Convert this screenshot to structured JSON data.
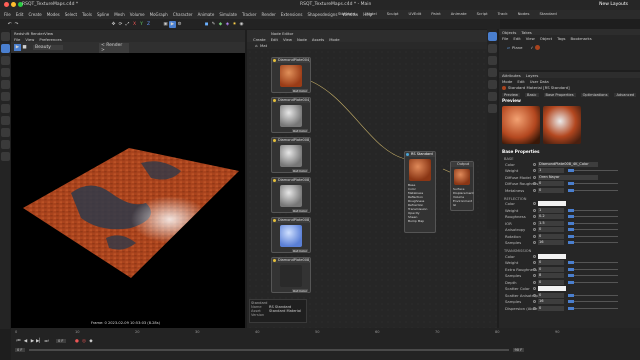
{
  "titlebar": {
    "title": "RSQT_TextureMaps.c4d * - Main",
    "file_tab": "RSQT_TextureMaps.c4d *",
    "new_layout": "New Layouts",
    "layouts": [
      "Standard",
      "Model",
      "Sculpt",
      "UVEdit",
      "Paint",
      "Animate",
      "Script",
      "Track",
      "Nodes",
      "Standard"
    ]
  },
  "main_menu": [
    "File",
    "Edit",
    "Create",
    "Modes",
    "Select",
    "Tools",
    "Spline",
    "Mesh",
    "Volume",
    "MoGraph",
    "Character",
    "Animate",
    "Simulate",
    "Tracker",
    "Render",
    "Extensions",
    "Shapesdesigns",
    "Window",
    "Help"
  ],
  "viewport": {
    "title": "Redshift RenderView",
    "menu": [
      "File",
      "View",
      "Preferences"
    ],
    "dropdown_left": "Beauty",
    "dropdown_mid": "< Render >",
    "frame_info": "Frame: 0  2023-02-09  10:53:03  (8.28s)"
  },
  "node_editor": {
    "title": "Node Editor",
    "menu": [
      "Create",
      "Edit",
      "View",
      "Node",
      "Assets",
      "Mode"
    ],
    "breadcrumb": "Mat",
    "texture_nodes": [
      {
        "name": "DiamondPlate004_4...",
        "port": "Out Color"
      },
      {
        "name": "DiamondPlate004_4...",
        "port": "Out Color"
      },
      {
        "name": "DiamondPlate008_4...",
        "port": "Out Color"
      },
      {
        "name": "DiamondPlate008_4...",
        "port": "Out Color"
      },
      {
        "name": "DiamondPlate008_4...",
        "port": "Out Color"
      },
      {
        "name": "DiamondPlate008_4...",
        "port": "Out Color"
      }
    ],
    "rs_node": {
      "name": "RS Standard",
      "ports": [
        "Base",
        "Color",
        "Metalness",
        "Reflection",
        "Roughness",
        "Refraction",
        "Transmission",
        "Opacity",
        "Sheen",
        "Bump Map"
      ]
    },
    "output_node": {
      "name": "Output",
      "ports": [
        "Surface",
        "Displacement",
        "Volume",
        "Environment",
        "GI"
      ]
    },
    "info_panel": {
      "rows": [
        {
          "label": "Name",
          "value": "RS Standard"
        },
        {
          "label": "Asset",
          "value": "Standard Material"
        },
        {
          "label": "Version",
          "value": ""
        }
      ],
      "header": "Standard"
    }
  },
  "objects_panel": {
    "tabs": [
      "Objects",
      "Takes"
    ],
    "menu": [
      "File",
      "Edit",
      "View",
      "Object",
      "Tags",
      "Bookmarks"
    ],
    "items": [
      {
        "name": "Plane"
      }
    ]
  },
  "attributes": {
    "tabs": [
      "Attributes",
      "Layers"
    ],
    "menu": [
      "Mode",
      "Edit",
      "User Data"
    ],
    "material_title": "Standard Material [RS Standard]",
    "subtabs": [
      "Preview",
      "Basic",
      "Base Properties",
      "Optimizations",
      "Advanced"
    ],
    "preview_label": "Preview",
    "base_props_title": "Base Properties",
    "base": {
      "title": "BASE",
      "rows": [
        {
          "label": "Color",
          "value": "DiamondPlate008_4K_Color"
        },
        {
          "label": "Weight",
          "value": "1"
        },
        {
          "label": "Diffuse Model",
          "value": "Oren Nayar"
        },
        {
          "label": "Diffuse Roughness",
          "value": "0"
        },
        {
          "label": "Metalness",
          "value": "0"
        }
      ]
    },
    "reflection": {
      "title": "REFLECTION",
      "rows": [
        {
          "label": "Color",
          "value": ""
        },
        {
          "label": "Weight",
          "value": "1"
        },
        {
          "label": "Roughness",
          "value": "0.2"
        },
        {
          "label": "IOR",
          "value": "1.5"
        },
        {
          "label": "Anisotropy",
          "value": "0"
        },
        {
          "label": "Rotation",
          "value": "0"
        },
        {
          "label": "Samples",
          "value": "16"
        }
      ]
    },
    "transmission": {
      "title": "TRANSMISSION",
      "rows": [
        {
          "label": "Color",
          "value": ""
        },
        {
          "label": "Weight",
          "value": "0"
        },
        {
          "label": "Extra Roughness",
          "value": "0"
        },
        {
          "label": "Samples",
          "value": "8"
        },
        {
          "label": "Depth",
          "value": "0"
        },
        {
          "label": "Scatter Color",
          "value": ""
        },
        {
          "label": "Scatter Anisotropy",
          "value": "0"
        },
        {
          "label": "Samples",
          "value": "16"
        },
        {
          "label": "Dispersion (Abbe)",
          "value": "0"
        }
      ]
    }
  },
  "timeline": {
    "current_frame": "0 F",
    "end_frame": "90 F",
    "start": "0 F",
    "end": "90 F",
    "ruler": [
      "0",
      "10",
      "20",
      "30",
      "40",
      "50",
      "60",
      "70",
      "80",
      "90"
    ]
  },
  "colors": {
    "accent": "#4a7fcf",
    "node_yellow": "#e8c23a",
    "rust": "#b3471f"
  }
}
